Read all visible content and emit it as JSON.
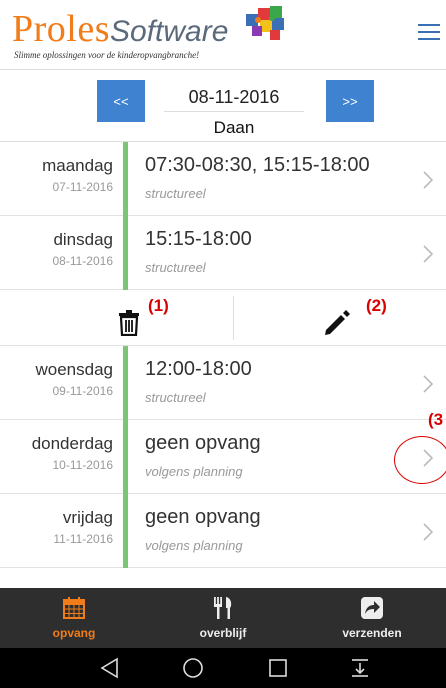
{
  "header": {
    "logo_proles": "Proles",
    "logo_software": "Software",
    "logo_tagline": "Slimme oplossingen voor de kinderopvangbranche!"
  },
  "datebar": {
    "prev_label": "<<",
    "next_label": ">>",
    "date_value": "08-11-2016",
    "child_name": "Daan"
  },
  "days": [
    {
      "name": "maandag",
      "date": "07-11-2016",
      "time": "07:30-08:30, 15:15-18:00",
      "sub": "structureel"
    },
    {
      "name": "dinsdag",
      "date": "08-11-2016",
      "time": "15:15-18:00",
      "sub": "structureel"
    },
    {
      "name": "woensdag",
      "date": "09-11-2016",
      "time": "12:00-18:00",
      "sub": "structureel"
    },
    {
      "name": "donderdag",
      "date": "10-11-2016",
      "time": "geen opvang",
      "sub": "volgens planning"
    },
    {
      "name": "vrijdag",
      "date": "11-11-2016",
      "time": "geen opvang",
      "sub": "volgens planning"
    }
  ],
  "annotations": {
    "a1": "(1)",
    "a2": "(2)",
    "a3": "(3"
  },
  "tabs": [
    {
      "label": "opvang",
      "icon": "calendar-icon"
    },
    {
      "label": "overblijf",
      "icon": "fork-knife-icon"
    },
    {
      "label": "verzenden",
      "icon": "share-icon"
    }
  ],
  "colors": {
    "brand_orange": "#f07d1a",
    "button_blue": "#3f82d0",
    "status_green": "#7cc576",
    "annotation_red": "#d90000",
    "tabbar_bg": "#2e2e2e"
  }
}
